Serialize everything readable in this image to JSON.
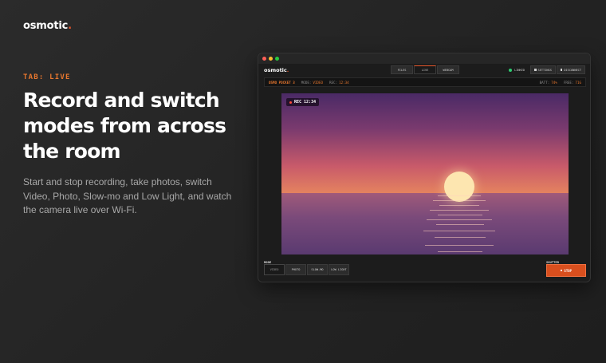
{
  "brand": {
    "name": "osmotic",
    "dot": ".",
    "accent": "#e8562a"
  },
  "hero": {
    "tab_label": "TAB: LIVE",
    "headline": "Record and switch modes from across the room",
    "description": "Start and stop recording, take photos, switch Video, Photo, Slow-mo and Low Light, and watch the camera live over Wi-Fi."
  },
  "app": {
    "logo": "osmotic",
    "logo_dot": ".",
    "tabs": [
      {
        "label": "FILES"
      },
      {
        "label": "LIVE"
      },
      {
        "label": "WEBCAM"
      }
    ],
    "active_tab": "LIVE",
    "linked_label": "LINKED",
    "settings_label": "SETTINGS",
    "disconnect_label": "DISCONNECT",
    "status": {
      "device": "OSMO POCKET 3",
      "mode_key": "MODE:",
      "mode_value": "VIDEO",
      "rec_key": "REC:",
      "rec_value": "12:34",
      "batt_key": "BATT:",
      "batt_value": "74%",
      "free_key": "FREE:",
      "free_value": "71G"
    },
    "preview": {
      "rec_badge": "REC 12:34"
    },
    "mode_section_label": "MODE",
    "modes": [
      {
        "label": "VIDEO"
      },
      {
        "label": "PHOTO"
      },
      {
        "label": "SLOW-MO"
      },
      {
        "label": "LOW LIGHT"
      }
    ],
    "shutter_label": "SHUTTER",
    "stop_label": "STOP"
  }
}
